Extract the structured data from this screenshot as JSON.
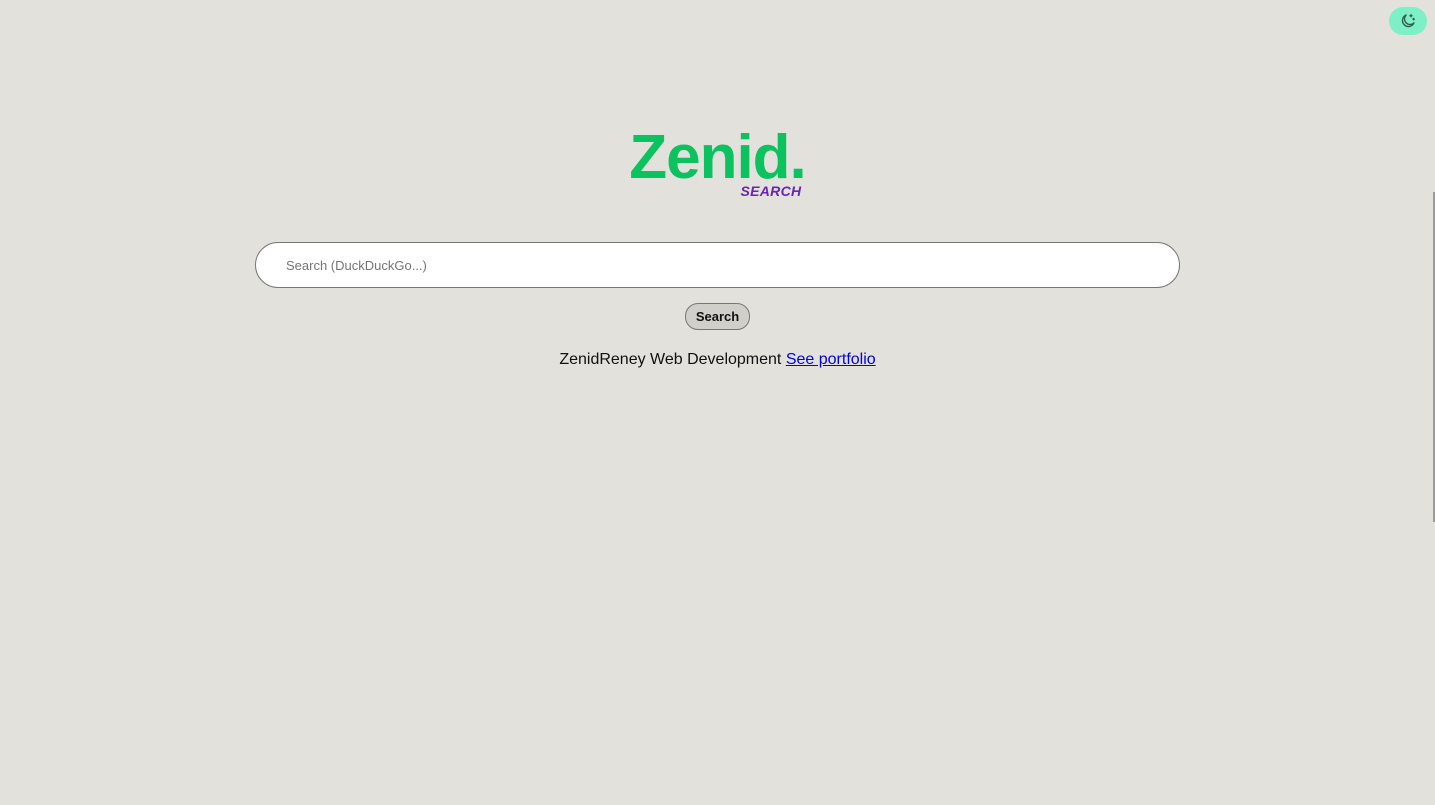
{
  "theme_toggle": {
    "icon": "moon-stars-icon",
    "color": "#7ef0c7"
  },
  "logo": {
    "wordmark": "Zenid.",
    "subtitle": "SEARCH",
    "wordmark_color": "#0cc25e",
    "subtitle_color": "#6a22b8"
  },
  "search": {
    "placeholder": "Search (DuckDuckGo...)",
    "value": "",
    "button_label": "Search"
  },
  "footer": {
    "text": "ZenidReney Web Development",
    "link_label": "See portfolio",
    "link_color": "#0000ee"
  },
  "colors": {
    "background": "#e2e1dc"
  }
}
